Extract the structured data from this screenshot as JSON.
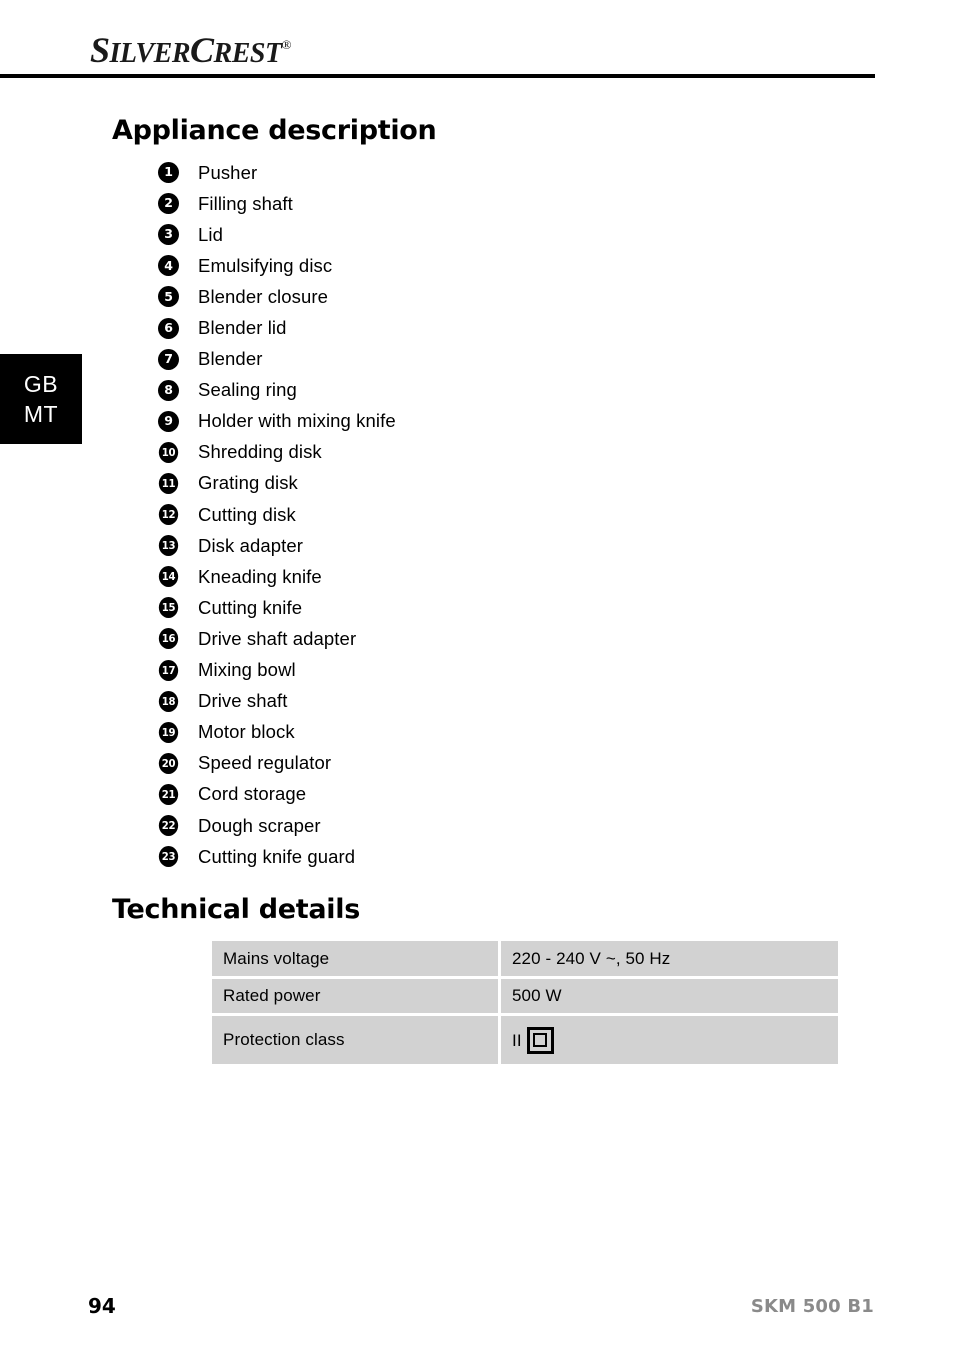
{
  "header": {
    "brand_primary": "S",
    "brand_rest_1": "ILVER",
    "brand_primary_2": "C",
    "brand_rest_2": "REST",
    "brand_registered": "®",
    "brand_full": "SILVERCREST"
  },
  "language_tab": {
    "line1": "GB",
    "line2": "MT"
  },
  "sections": {
    "appliance_heading": "Appliance description",
    "technical_heading": "Technical details"
  },
  "parts": [
    {
      "number": "1",
      "label": "Pusher"
    },
    {
      "number": "2",
      "label": "Filling shaft"
    },
    {
      "number": "3",
      "label": "Lid"
    },
    {
      "number": "4",
      "label": "Emulsifying disc"
    },
    {
      "number": "5",
      "label": "Blender closure"
    },
    {
      "number": "6",
      "label": "Blender lid"
    },
    {
      "number": "7",
      "label": "Blender"
    },
    {
      "number": "8",
      "label": "Sealing ring"
    },
    {
      "number": "9",
      "label": "Holder with mixing knife"
    },
    {
      "number": "10",
      "label": "Shredding disk"
    },
    {
      "number": "11",
      "label": "Grating disk"
    },
    {
      "number": "12",
      "label": "Cutting disk"
    },
    {
      "number": "13",
      "label": "Disk adapter"
    },
    {
      "number": "14",
      "label": "Kneading knife"
    },
    {
      "number": "15",
      "label": "Cutting knife"
    },
    {
      "number": "16",
      "label": "Drive shaft adapter"
    },
    {
      "number": "17",
      "label": "Mixing bowl"
    },
    {
      "number": "18",
      "label": "Drive shaft"
    },
    {
      "number": "19",
      "label": "Motor block"
    },
    {
      "number": "20",
      "label": "Speed regulator"
    },
    {
      "number": "21",
      "label": "Cord storage"
    },
    {
      "number": "22",
      "label": "Dough scraper"
    },
    {
      "number": "23",
      "label": "Cutting knife guard"
    }
  ],
  "technical_table": {
    "rows": [
      {
        "key": "Mains voltage",
        "value": "220 - 240 V ~, 50 Hz"
      },
      {
        "key": "Rated power",
        "value": "500 W"
      },
      {
        "key": "Protection class",
        "value": "II",
        "symbol": "class-2-double-insulation"
      }
    ]
  },
  "footer": {
    "page_number": "94",
    "model": "SKM 500 B1"
  },
  "colors": {
    "table_cell_bg": "#d2d2d2",
    "footer_model": "#8a8a8a",
    "text": "#000000",
    "tab_bg": "#000000"
  }
}
